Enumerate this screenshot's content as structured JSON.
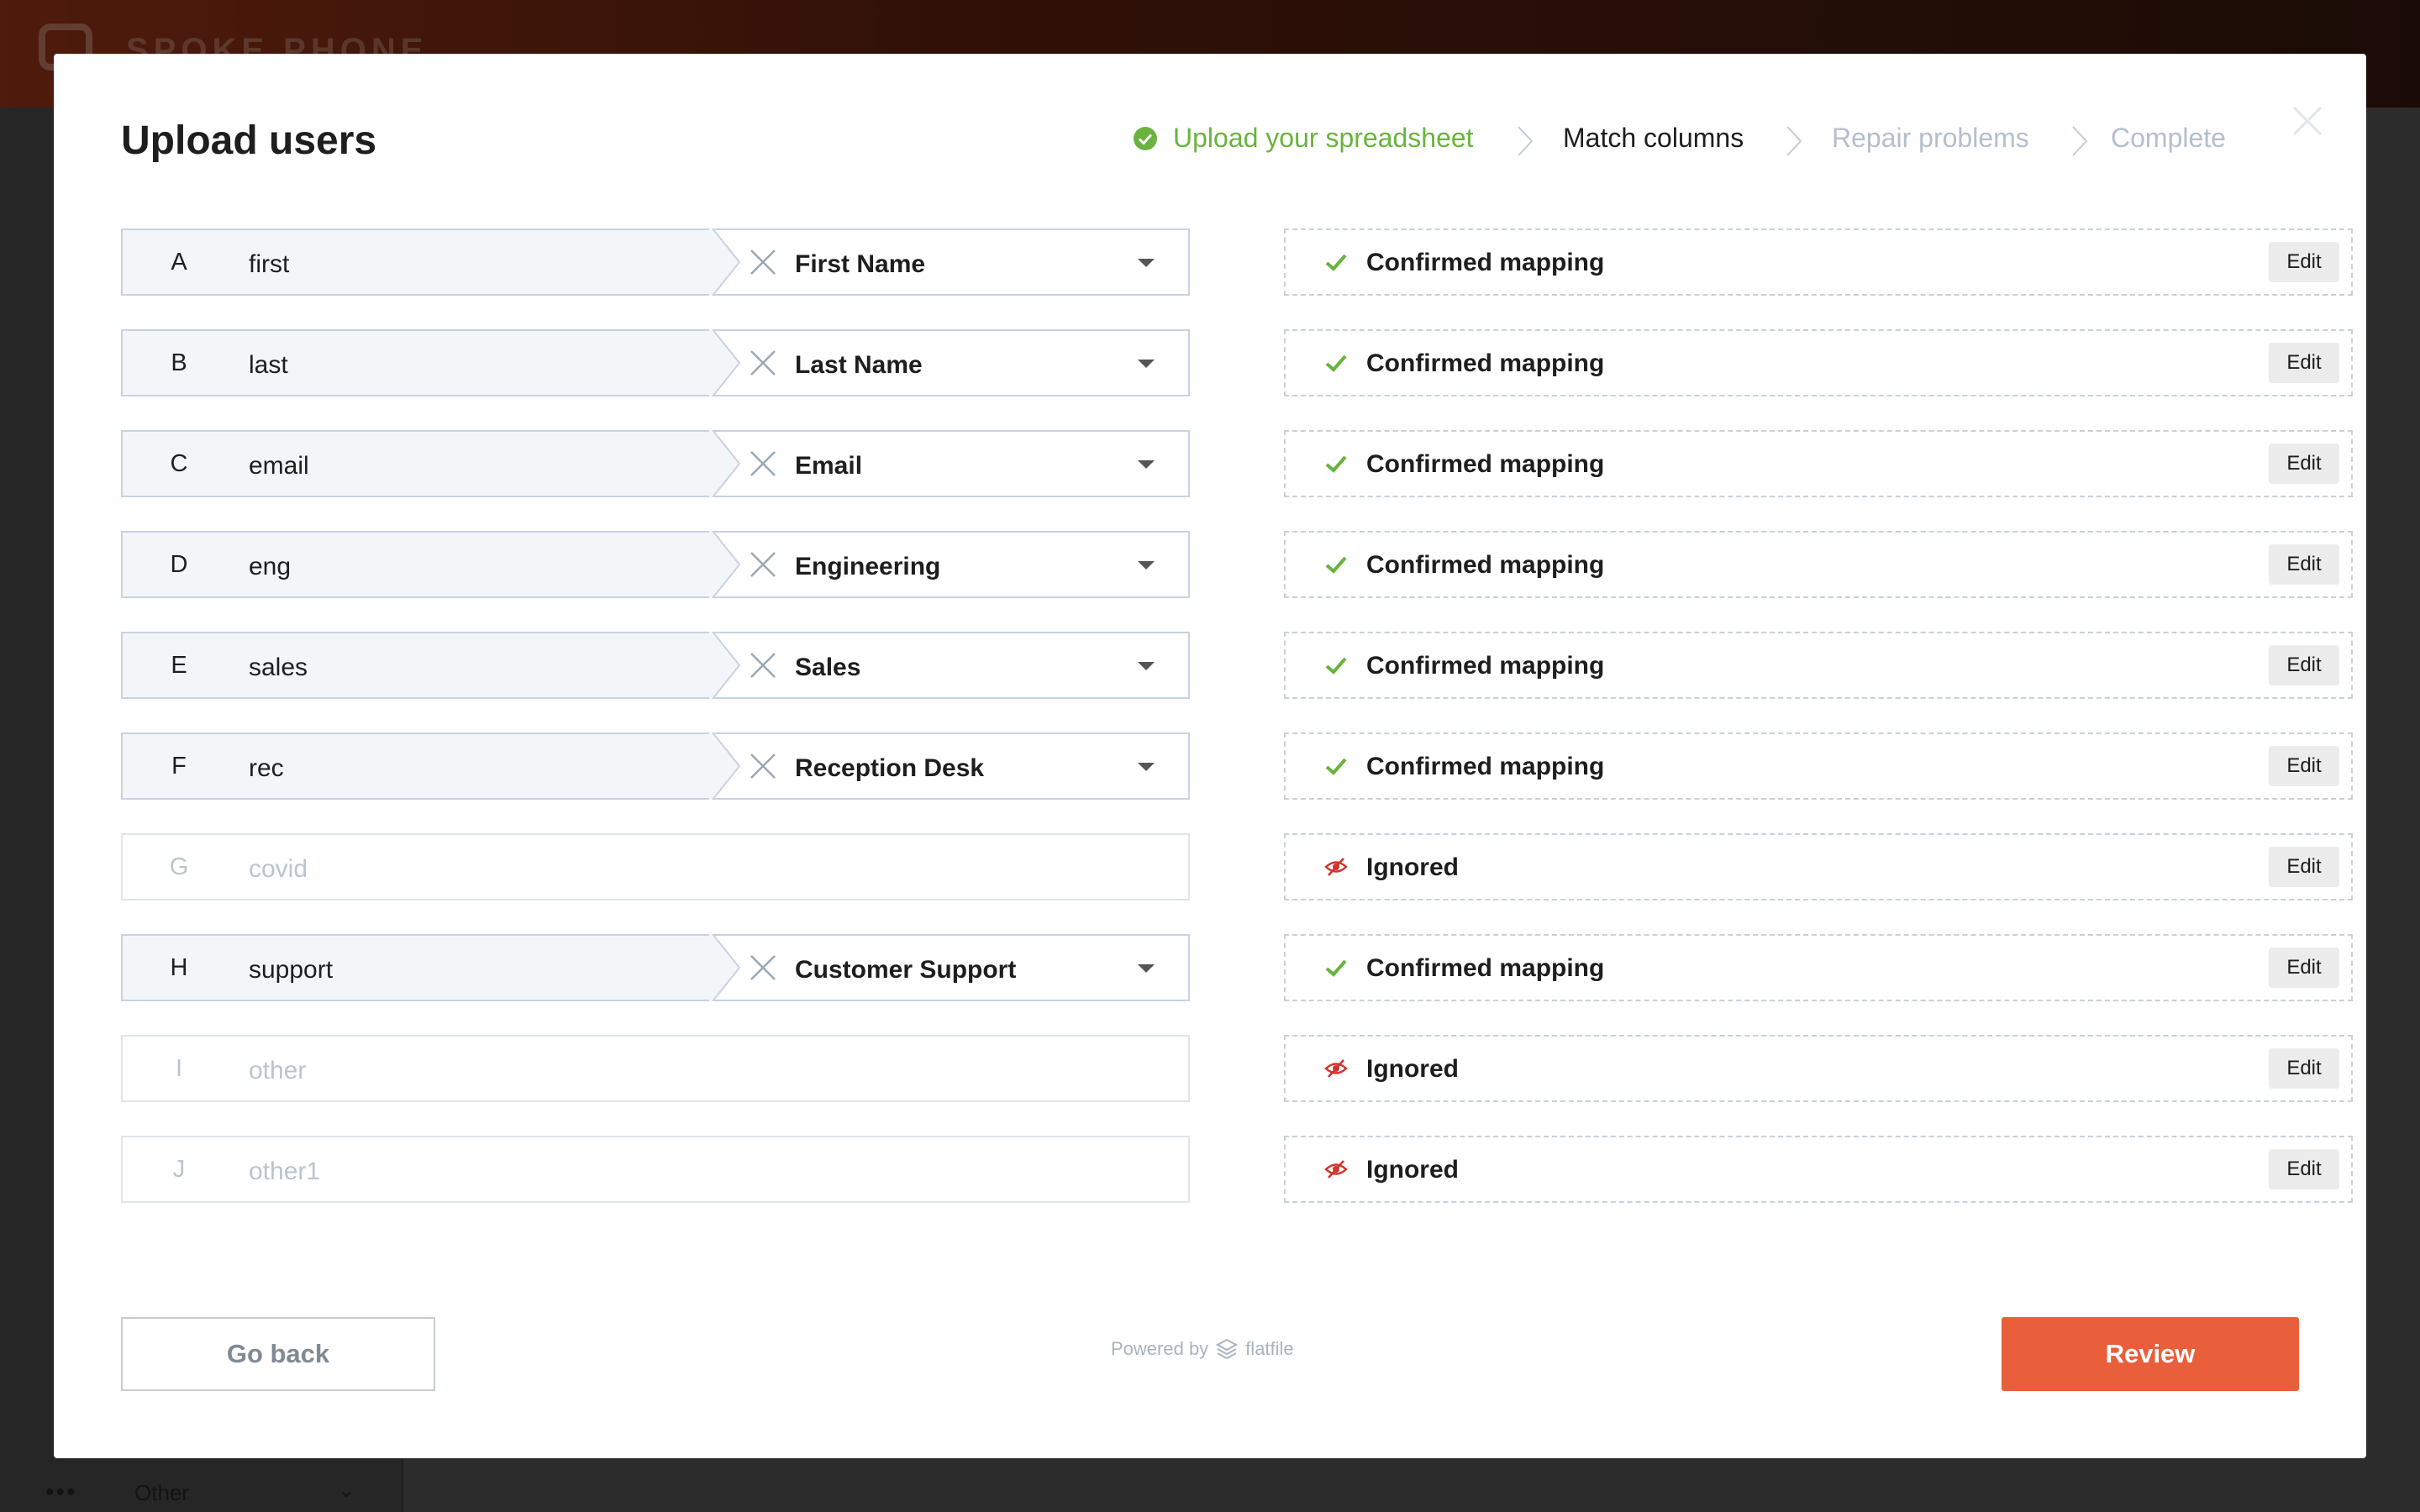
{
  "background": {
    "brand": "SPOKE PHONE",
    "sidebar_bottom_item": "Other"
  },
  "modal": {
    "title": "Upload users"
  },
  "stepper": {
    "steps": [
      {
        "label": "Upload your spreadsheet",
        "state": "done"
      },
      {
        "label": "Match columns",
        "state": "active"
      },
      {
        "label": "Repair problems",
        "state": "todo"
      },
      {
        "label": "Complete",
        "state": "todo"
      }
    ]
  },
  "mappings": [
    {
      "letter": "A",
      "source": "first",
      "target": "First Name",
      "status": "Confirmed mapping",
      "edit": "Edit"
    },
    {
      "letter": "B",
      "source": "last",
      "target": "Last Name",
      "status": "Confirmed mapping",
      "edit": "Edit"
    },
    {
      "letter": "C",
      "source": "email",
      "target": "Email",
      "status": "Confirmed mapping",
      "edit": "Edit"
    },
    {
      "letter": "D",
      "source": "eng",
      "target": "Engineering",
      "status": "Confirmed mapping",
      "edit": "Edit"
    },
    {
      "letter": "E",
      "source": "sales",
      "target": "Sales",
      "status": "Confirmed mapping",
      "edit": "Edit"
    },
    {
      "letter": "F",
      "source": "rec",
      "target": "Reception Desk",
      "status": "Confirmed mapping",
      "edit": "Edit"
    },
    {
      "letter": "G",
      "source": "covid",
      "target": "",
      "status": "Ignored",
      "edit": "Edit"
    },
    {
      "letter": "H",
      "source": "support",
      "target": "Customer Support",
      "status": "Confirmed mapping",
      "edit": "Edit"
    },
    {
      "letter": "I",
      "source": "other",
      "target": "",
      "status": "Ignored",
      "edit": "Edit"
    },
    {
      "letter": "J",
      "source": "other1",
      "target": "",
      "status": "Ignored",
      "edit": "Edit"
    }
  ],
  "footer": {
    "go_back": "Go back",
    "powered_by": "Powered by",
    "powered_brand": "flatfile",
    "review": "Review"
  },
  "colors": {
    "accent": "#ea5f3b",
    "success": "#6ab33e",
    "ignored": "#d0342c",
    "todo_step": "#b4bfcc"
  }
}
